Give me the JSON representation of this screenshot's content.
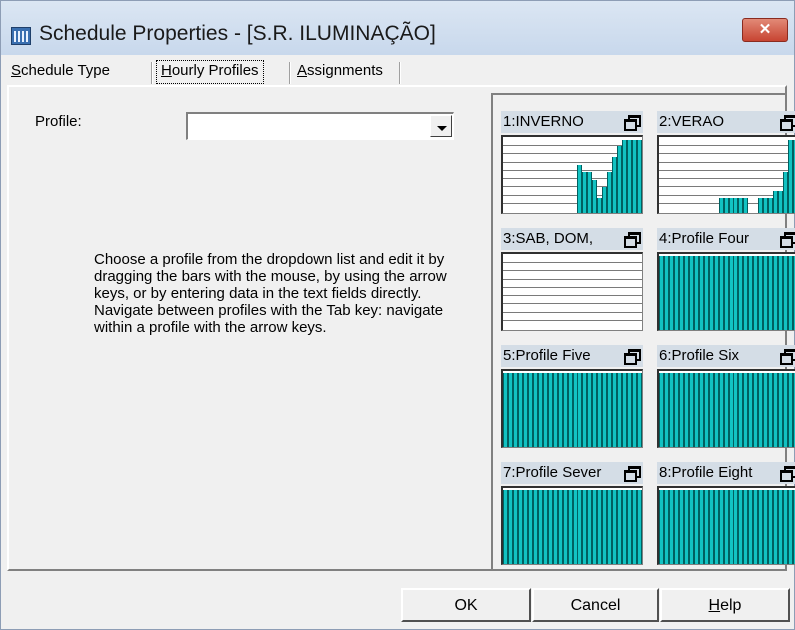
{
  "window": {
    "title": "Schedule Properties - [S.R. ILUMINAÇÃO]",
    "close_label": "✕"
  },
  "tabs": [
    {
      "pre": "",
      "u": "S",
      "post": "chedule Type",
      "active": false
    },
    {
      "pre": "",
      "u": "H",
      "post": "ourly Profiles",
      "active": true
    },
    {
      "pre": "",
      "u": "A",
      "post": "ssignments",
      "active": false
    }
  ],
  "form": {
    "profile_label": "Profile:",
    "profile_value": "",
    "instructions": "Choose a profile from the dropdown list and edit it by dragging the bars with the mouse, by using the arrow keys, or by entering data in the text fields directly.  Navigate between profiles with the Tab key: navigate within a profile with the arrow keys."
  },
  "profiles": [
    {
      "title": "1:INVERNO",
      "hours": [
        0,
        0,
        0,
        0,
        0,
        0,
        0,
        0,
        0,
        0,
        0,
        0,
        0,
        0,
        0,
        0.65,
        0.55,
        0.55,
        0.45,
        0.2,
        0.35,
        0.55,
        0.75,
        0.9,
        0.98,
        0.98,
        0.98,
        0.98
      ]
    },
    {
      "title": "2:VERAO",
      "hours": [
        0,
        0,
        0,
        0,
        0,
        0,
        0,
        0,
        0,
        0,
        0,
        0,
        0.2,
        0.2,
        0.2,
        0.2,
        0.2,
        0.2,
        0,
        0,
        0.2,
        0.2,
        0.2,
        0.3,
        0.3,
        0.55,
        0.98,
        0.98
      ]
    },
    {
      "title": "3:SAB, DOM, ",
      "hours": [
        0,
        0,
        0,
        0,
        0,
        0,
        0,
        0,
        0,
        0,
        0,
        0,
        0,
        0,
        0,
        0,
        0,
        0,
        0,
        0,
        0,
        0,
        0,
        0,
        0,
        0,
        0,
        0
      ]
    },
    {
      "title": "4:Profile Four",
      "hours": [
        1,
        1,
        1,
        1,
        1,
        1,
        1,
        1,
        1,
        1,
        1,
        1,
        1,
        1,
        1,
        1,
        1,
        1,
        1,
        1,
        1,
        1,
        1,
        1,
        1,
        1,
        1,
        1
      ]
    },
    {
      "title": "5:Profile Five",
      "hours": [
        1,
        1,
        1,
        1,
        1,
        1,
        1,
        1,
        1,
        1,
        1,
        1,
        1,
        1,
        1,
        1,
        1,
        1,
        1,
        1,
        1,
        1,
        1,
        1,
        1,
        1,
        1,
        1
      ]
    },
    {
      "title": "6:Profile Six",
      "hours": [
        1,
        1,
        1,
        1,
        1,
        1,
        1,
        1,
        1,
        1,
        1,
        1,
        1,
        1,
        1,
        1,
        1,
        1,
        1,
        1,
        1,
        1,
        1,
        1,
        1,
        1,
        1,
        1
      ]
    },
    {
      "title": "7:Profile Sever",
      "hours": [
        1,
        1,
        1,
        1,
        1,
        1,
        1,
        1,
        1,
        1,
        1,
        1,
        1,
        1,
        1,
        1,
        1,
        1,
        1,
        1,
        1,
        1,
        1,
        1,
        1,
        1,
        1,
        1
      ]
    },
    {
      "title": "8:Profile Eight",
      "hours": [
        1,
        1,
        1,
        1,
        1,
        1,
        1,
        1,
        1,
        1,
        1,
        1,
        1,
        1,
        1,
        1,
        1,
        1,
        1,
        1,
        1,
        1,
        1,
        1,
        1,
        1,
        1,
        1
      ]
    }
  ],
  "buttons": {
    "ok": {
      "pre": "",
      "u": "",
      "post": "OK"
    },
    "cancel": {
      "pre": "",
      "u": "",
      "post": "Cancel"
    },
    "help": {
      "pre": "",
      "u": "H",
      "post": "elp"
    }
  },
  "colors": {
    "bar": "#12c2c2",
    "bar_edge": "#006060"
  }
}
